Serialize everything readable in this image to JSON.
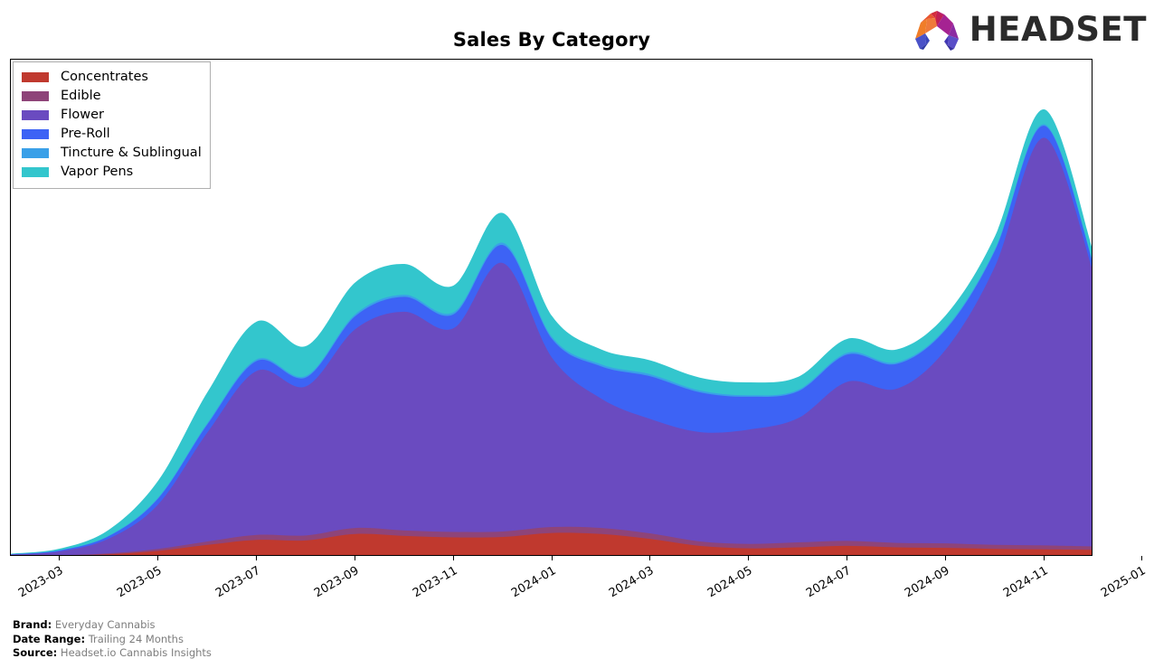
{
  "header": {
    "title": "Sales By Category",
    "logo_text": "HEADSET",
    "logo_icon": "headset-logo-icon"
  },
  "footer": {
    "rows": [
      {
        "key": "Brand:",
        "value": "Everyday Cannabis"
      },
      {
        "key": "Date Range:",
        "value": "Trailing 24 Months"
      },
      {
        "key": "Source:",
        "value": "Headset.io Cannabis Insights"
      }
    ]
  },
  "chart_data": {
    "type": "area",
    "stacked": true,
    "title": "Sales By Category",
    "xlabel": "",
    "ylabel": "",
    "grid": false,
    "legend_position": "upper left",
    "axis": {
      "x_tick_labels": [
        "2023-03",
        "2023-05",
        "2023-07",
        "2023-09",
        "2023-11",
        "2024-01",
        "2024-03",
        "2024-05",
        "2024-07",
        "2024-09",
        "2024-11",
        "2025-01"
      ],
      "x_tick_rotation": -30,
      "y_tick_labels": [],
      "ylim": [
        0,
        100
      ]
    },
    "x": [
      "2023-02",
      "2023-03",
      "2023-04",
      "2023-05",
      "2023-06",
      "2023-07",
      "2023-08",
      "2023-09",
      "2023-10",
      "2023-11",
      "2023-12",
      "2024-01",
      "2024-02",
      "2024-03",
      "2024-04",
      "2024-05",
      "2024-06",
      "2024-07",
      "2024-08",
      "2024-09",
      "2024-10",
      "2024-11",
      "2024-12"
    ],
    "series": [
      {
        "name": "Concentrates",
        "color": "#c0392e",
        "values": [
          0.1,
          0.2,
          0.5,
          1.2,
          2.4,
          3.4,
          3.3,
          4.6,
          4.2,
          3.9,
          4.0,
          4.8,
          4.6,
          3.6,
          2.2,
          1.7,
          1.9,
          2.2,
          1.9,
          1.8,
          1.6,
          1.5,
          1.4
        ]
      },
      {
        "name": "Edible",
        "color": "#8e4479",
        "values": [
          0.05,
          0.1,
          0.2,
          0.4,
          0.7,
          1.0,
          1.0,
          1.2,
          1.1,
          1.1,
          1.1,
          1.2,
          1.2,
          1.1,
          0.9,
          0.9,
          1.0,
          1.0,
          0.9,
          0.9,
          0.8,
          0.8,
          0.7
        ]
      },
      {
        "name": "Flower",
        "color": "#6a4bc0",
        "values": [
          0.3,
          0.8,
          3.0,
          9.0,
          22.0,
          33.0,
          30.0,
          40.0,
          44.0,
          41.0,
          54.0,
          34.0,
          26.0,
          23.0,
          22.0,
          23.0,
          25.0,
          32.0,
          31.0,
          39.0,
          56.0,
          82.0,
          55.0
        ]
      },
      {
        "name": "Pre-Roll",
        "color": "#3d63f5",
        "values": [
          0.05,
          0.2,
          0.5,
          1.2,
          1.6,
          2.0,
          1.8,
          2.6,
          3.0,
          2.8,
          3.6,
          3.8,
          6.5,
          8.6,
          8.0,
          6.6,
          5.4,
          5.5,
          5.0,
          4.0,
          3.2,
          2.4,
          1.7
        ]
      },
      {
        "name": "Tincture & Sublingual",
        "color": "#3aa0e8",
        "values": [
          0.02,
          0.05,
          0.1,
          0.2,
          0.3,
          0.35,
          0.3,
          0.4,
          0.4,
          0.4,
          0.45,
          0.4,
          0.4,
          0.4,
          0.35,
          0.3,
          0.3,
          0.35,
          0.3,
          0.3,
          0.3,
          0.3,
          0.25
        ]
      },
      {
        "name": "Vapor Pens",
        "color": "#33c6cd",
        "values": [
          0.1,
          0.3,
          1.2,
          3.4,
          6.2,
          7.6,
          6.0,
          6.4,
          6.2,
          5.4,
          6.0,
          4.2,
          3.0,
          2.8,
          2.6,
          2.6,
          2.6,
          2.8,
          2.6,
          2.6,
          2.6,
          3.0,
          2.2
        ]
      }
    ]
  }
}
